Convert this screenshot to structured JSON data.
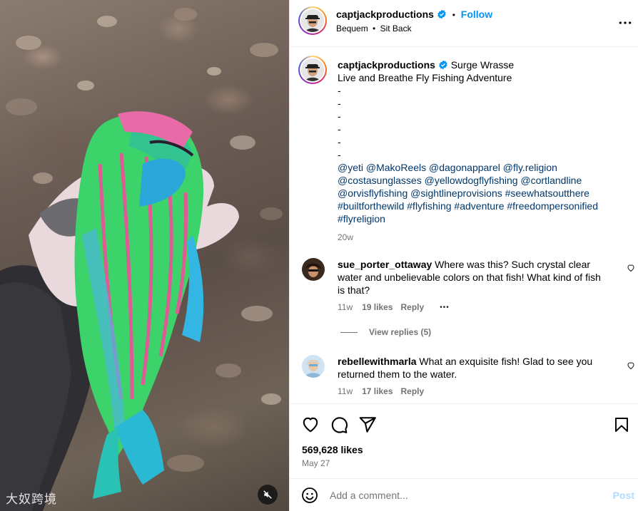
{
  "post_header": {
    "username": "captjackproductions",
    "follow_label": "Follow",
    "separator": "•",
    "audio_artist": "Bequem",
    "audio_title": "Sit Back"
  },
  "caption": {
    "username": "captjackproductions",
    "line1": "Surge Wrasse",
    "line2": "Live and Breathe Fly Fishing Adventure",
    "dashes": [
      "-",
      "-",
      "-",
      "-",
      "-",
      "-"
    ],
    "tags_line1": "@yeti @MakoReels @dagonapparel @fly.religion",
    "tags_line2": "@costasunglasses @yellowdogflyfishing @cortlandline",
    "tags_line3": "@orvisflyfishing @sightlineprovisions #seewhatsoutthere",
    "tags_line4": "#builtforthewild #flyfishing #adventure #freedompersonified",
    "tags_line5": "#flyreligion",
    "time": "20w"
  },
  "comments": [
    {
      "username": "sue_porter_ottaway",
      "text_line1": "Where was this? Such crystal clear",
      "text_line2": "water and unbelievable colors on that fish! What kind of fish",
      "text_line3": "is that?",
      "time": "11w",
      "likes": "19 likes",
      "reply_label": "Reply",
      "more": "•••",
      "view_replies": "View replies (5)"
    },
    {
      "username": "rebellewithmarla",
      "text_line1": "What an exquisite fish! Glad to see you",
      "text_line2": "returned them to the water.",
      "time": "11w",
      "likes": "17 likes",
      "reply_label": "Reply"
    }
  ],
  "engagement": {
    "likes": "569,628 likes",
    "date": "May 27"
  },
  "add_comment": {
    "placeholder": "Add a comment...",
    "post_label": "Post"
  },
  "media": {
    "watermark": "大奴跨境"
  },
  "colors": {
    "accent_blue": "#0095f6",
    "tag_blue": "#00376b",
    "muted": "#737373"
  },
  "icons": [
    "verified-badge-icon",
    "more-options-icon",
    "heart-icon",
    "comment-icon",
    "share-icon",
    "bookmark-icon",
    "emoji-icon",
    "mute-icon"
  ]
}
